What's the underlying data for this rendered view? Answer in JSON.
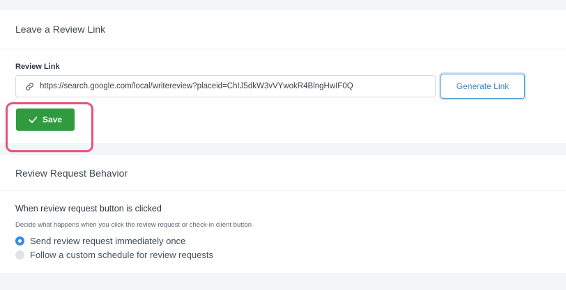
{
  "link_card": {
    "title": "Leave a Review Link",
    "field_label": "Review Link",
    "field_value": "https://search.google.com/local/writereview?placeid=ChIJ5dkW3vVYwokR4BlngHwIF0Q",
    "generate_label": "Generate Link",
    "save_label": "Save",
    "icons": {
      "link": "link-icon",
      "save": "checkmark-icon"
    }
  },
  "behavior_card": {
    "title": "Review Request Behavior",
    "section_title": "When review request button is clicked",
    "section_desc": "Decide what happens when you click the review request or check-in client button",
    "options": [
      {
        "label": "Send review request immediately once",
        "selected": true
      },
      {
        "label": "Follow a custom schedule for review requests",
        "selected": false
      }
    ]
  },
  "colors": {
    "save_green": "#2f9b3e",
    "accent_blue": "#2d8cf0",
    "highlight_pink": "#e8527a"
  }
}
